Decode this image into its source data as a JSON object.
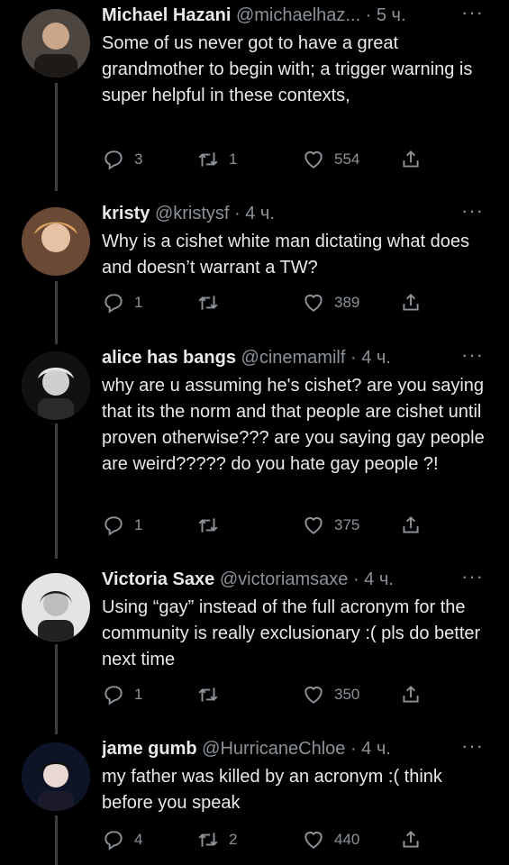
{
  "tweets": [
    {
      "name": "Michael Hazani",
      "handle": "@michaelhaz...",
      "time": "· 5 ч.",
      "more": "···",
      "text": "Some of us never got to have a great grandmother to begin with; a trigger warning is super helpful in these contexts,",
      "replies": "3",
      "retweets": "1",
      "likes": "554",
      "avatar_colors": [
        "#5a5048",
        "#2b2522"
      ]
    },
    {
      "name": "kristy",
      "handle": "@kristysf",
      "time": "· 4 ч.",
      "more": "···",
      "text": "Why is a cishet white man dictating what does and doesn’t warrant a TW?",
      "replies": "1",
      "retweets": "",
      "likes": "389",
      "avatar_colors": [
        "#b98a63",
        "#5c3a2a"
      ]
    },
    {
      "name": "alice has bangs",
      "handle": "@cinemamilf",
      "time": "· 4 ч.",
      "more": "···",
      "text": "why are u assuming he's cishet? are you saying that its the norm and that people are cishet until proven otherwise??? are you saying gay people are weird????? do you hate gay people ?!",
      "replies": "1",
      "retweets": "",
      "likes": "375",
      "avatar_colors": [
        "#9a9a9a",
        "#1c1c1c"
      ]
    },
    {
      "name": "Victoria Saxe",
      "handle": "@victoriamsaxe",
      "time": "· 4 ч.",
      "more": "···",
      "text": "Using “gay” instead of the full acronym for the community is really exclusionary :( pls do better next time",
      "replies": "1",
      "retweets": "",
      "likes": "350",
      "avatar_colors": [
        "#d8d8d8",
        "#2a2a2a"
      ]
    },
    {
      "name": "jame gumb",
      "handle": "@HurricaneChloe",
      "time": "· 4 ч.",
      "more": "···",
      "text": "my father was killed by an acronym :( think before you speak",
      "replies": "4",
      "retweets": "2",
      "likes": "440",
      "avatar_colors": [
        "#1c2a44",
        "#0a0a12"
      ]
    }
  ]
}
